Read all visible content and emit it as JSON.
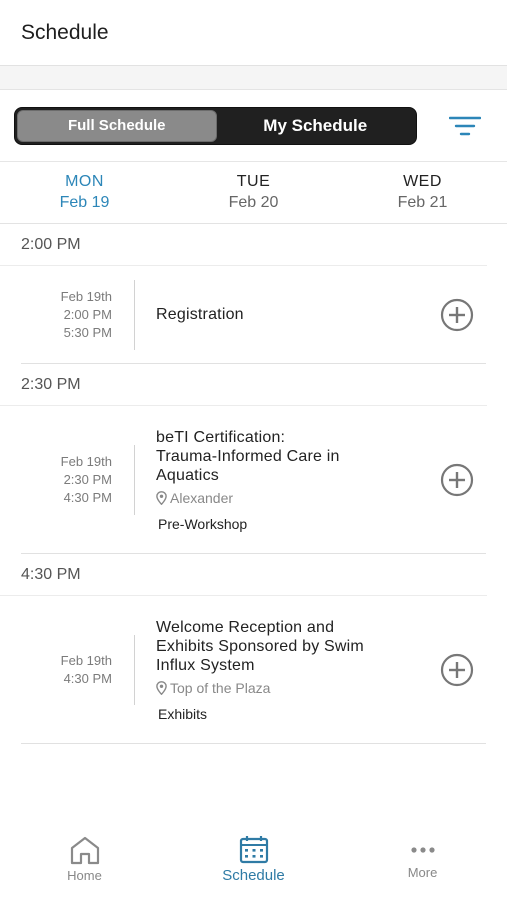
{
  "header": {
    "title": "Schedule"
  },
  "toggle": {
    "full_label": "Full Schedule",
    "my_label": "My Schedule"
  },
  "days": [
    {
      "dow": "MON",
      "date": "Feb 19"
    },
    {
      "dow": "TUE",
      "date": "Feb 20"
    },
    {
      "dow": "WED",
      "date": "Feb 21"
    }
  ],
  "sections": [
    {
      "time": "2:00 PM",
      "session": {
        "date": "Feb 19th",
        "start": "2:00 PM",
        "end": "5:30 PM",
        "title": "Registration"
      }
    },
    {
      "time": "2:30 PM",
      "session": {
        "date": "Feb 19th",
        "start": "2:30 PM",
        "end": "4:30 PM",
        "title_lines": [
          "beTI Certification:",
          "Trauma-Informed Care in",
          "Aquatics"
        ],
        "location": "Alexander",
        "track": "Pre-Workshop"
      }
    },
    {
      "time": "4:30 PM",
      "session": {
        "date": "Feb 19th",
        "start": "4:30 PM",
        "title_lines": [
          "Welcome Reception and",
          "Exhibits Sponsored by Swim",
          "Influx System"
        ],
        "location": "Top of the Plaza",
        "track": "Exhibits"
      }
    }
  ],
  "tabs": {
    "home": "Home",
    "schedule": "Schedule",
    "more": "More"
  },
  "colors": {
    "accent": "#2c86b8",
    "toggle_bg": "#202020",
    "toggle_active": "#8a8a8a"
  },
  "icons": {
    "filter": "filter-icon",
    "add": "plus-circle-icon",
    "location": "map-pin-icon",
    "home": "home-icon",
    "schedule": "calendar-icon",
    "more": "more-dots-icon"
  }
}
